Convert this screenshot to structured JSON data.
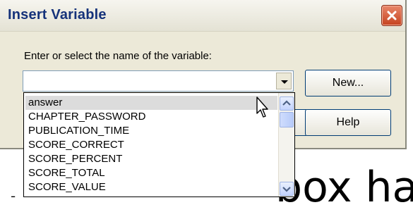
{
  "dialog": {
    "title": "Insert Variable",
    "prompt": "Enter or select the name of the variable:",
    "input_value": "",
    "buttons": {
      "new": "New...",
      "help": "Help"
    },
    "list_items": [
      "answer",
      "CHAPTER_PASSWORD",
      "PUBLICATION_TIME",
      "SCORE_CORRECT",
      "SCORE_PERCENT",
      "SCORE_TOTAL",
      "SCORE_VALUE"
    ],
    "hovered_item": "answer"
  },
  "background": {
    "partial_text": "box ha"
  },
  "icons": {
    "close": "close-icon",
    "dropdown": "chevron-down-icon",
    "scroll_up": "scroll-up-icon",
    "scroll_down": "scroll-down-icon",
    "cursor": "mouse-pointer-icon"
  },
  "colors": {
    "title_text": "#15327a",
    "dialog_bg": "#ece9d8",
    "close_button": "#c5421f",
    "hover_row": "#dcdcdc"
  }
}
